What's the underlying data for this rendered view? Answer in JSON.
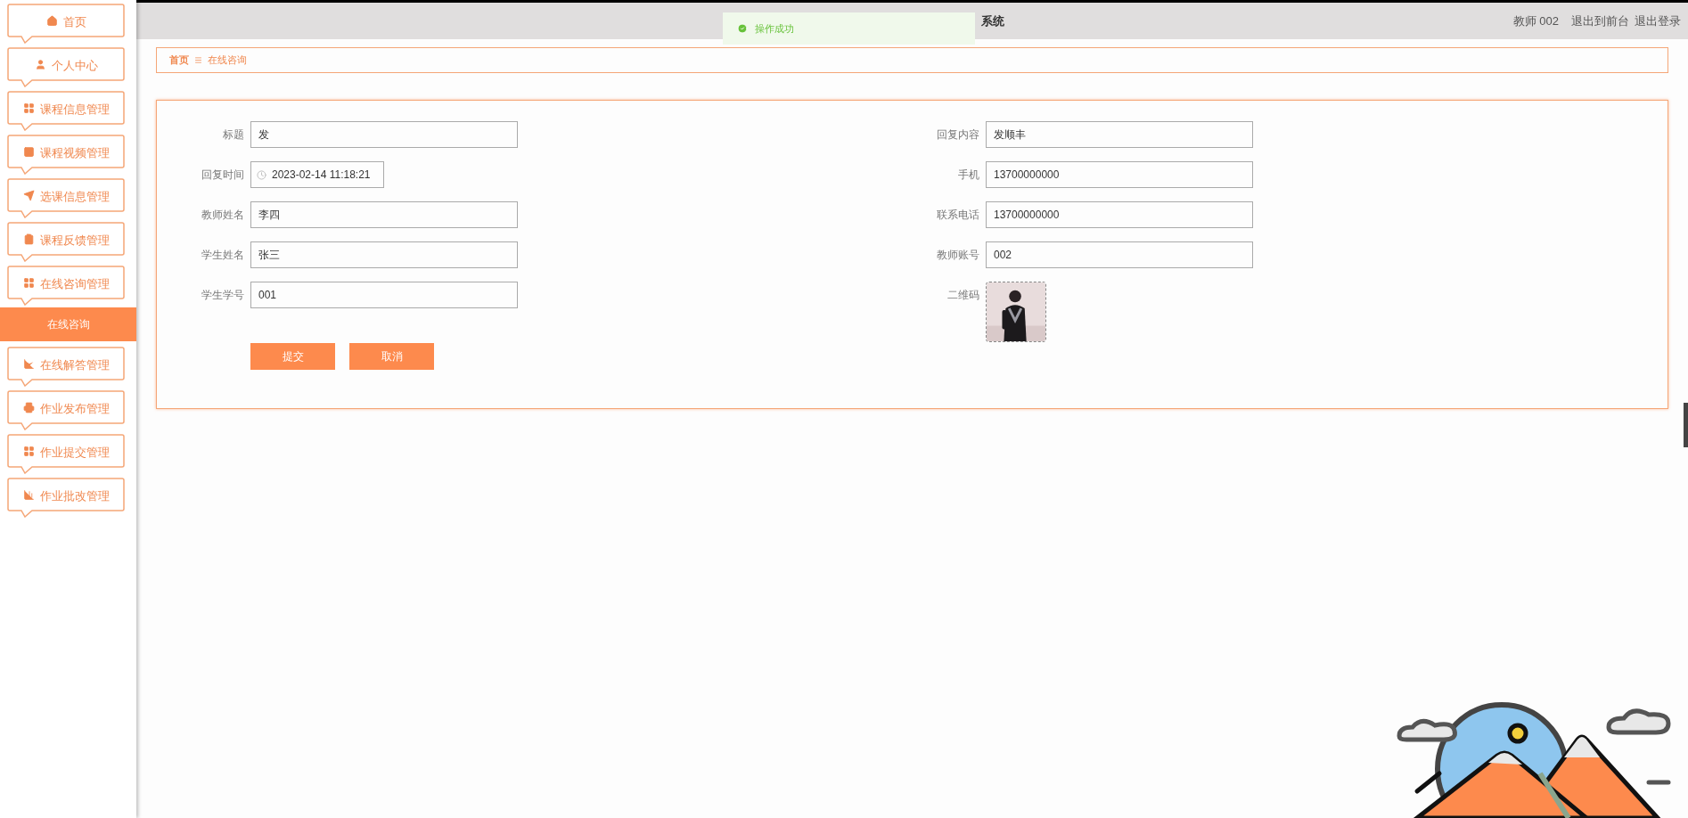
{
  "header": {
    "title": "系统",
    "user": "教师 002",
    "links": [
      "退出到前台",
      "退出登录"
    ]
  },
  "toast": {
    "message": "操作成功"
  },
  "sidebar": {
    "items": [
      {
        "label": "首页"
      },
      {
        "label": "个人中心"
      },
      {
        "label": "课程信息管理"
      },
      {
        "label": "课程视频管理"
      },
      {
        "label": "选课信息管理"
      },
      {
        "label": "课程反馈管理"
      },
      {
        "label": "在线咨询管理",
        "children": [
          {
            "label": "在线咨询",
            "selected": true
          }
        ]
      },
      {
        "label": "在线解答管理"
      },
      {
        "label": "作业发布管理"
      },
      {
        "label": "作业提交管理"
      },
      {
        "label": "作业批改管理"
      }
    ]
  },
  "breadcrumb": {
    "items": [
      "首页",
      "在线咨询"
    ]
  },
  "form": {
    "left": [
      {
        "kind": "text",
        "label": "标题",
        "value": "发"
      },
      {
        "kind": "datetime",
        "label": "回复时间",
        "value": "2023-02-14 11:18:21"
      },
      {
        "kind": "text",
        "label": "教师姓名",
        "value": "李四"
      },
      {
        "kind": "text",
        "label": "学生姓名",
        "value": "张三"
      },
      {
        "kind": "text",
        "label": "学生学号",
        "value": "001"
      }
    ],
    "right": [
      {
        "kind": "text",
        "label": "回复内容",
        "value": "发顺丰"
      },
      {
        "kind": "text",
        "label": "手机",
        "value": "13700000000"
      },
      {
        "kind": "text",
        "label": "联系电话",
        "value": "13700000000"
      },
      {
        "kind": "text",
        "label": "教师账号",
        "value": "002"
      },
      {
        "label": "二维码"
      }
    ],
    "buttons": [
      "提交",
      "取消"
    ]
  }
}
